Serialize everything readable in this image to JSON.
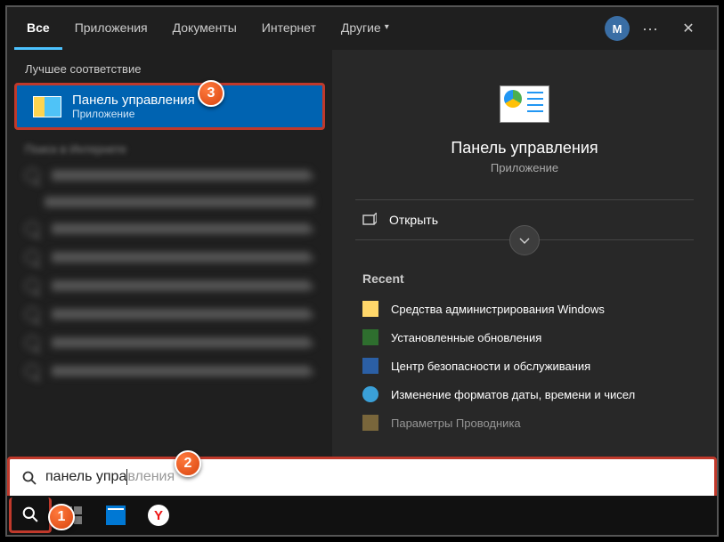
{
  "header": {
    "tabs": [
      "Все",
      "Приложения",
      "Документы",
      "Интернет",
      "Другие"
    ],
    "avatar_initial": "M"
  },
  "left": {
    "best_match_label": "Лучшее соответствие",
    "best_match": {
      "title": "Панель управления",
      "subtitle": "Приложение"
    },
    "web_label": "Поиск в Интернете"
  },
  "right": {
    "title": "Панель управления",
    "subtitle": "Приложение",
    "open": "Открыть",
    "recent_header": "Recent",
    "recent": [
      "Средства администрирования Windows",
      "Установленные обновления",
      "Центр безопасности и обслуживания",
      "Изменение форматов даты, времени и чисел",
      "Параметры Проводника"
    ]
  },
  "search": {
    "typed": "панель упра",
    "suggestion_tail": "вления"
  },
  "annotations": {
    "b1": "1",
    "b2": "2",
    "b3": "3"
  }
}
